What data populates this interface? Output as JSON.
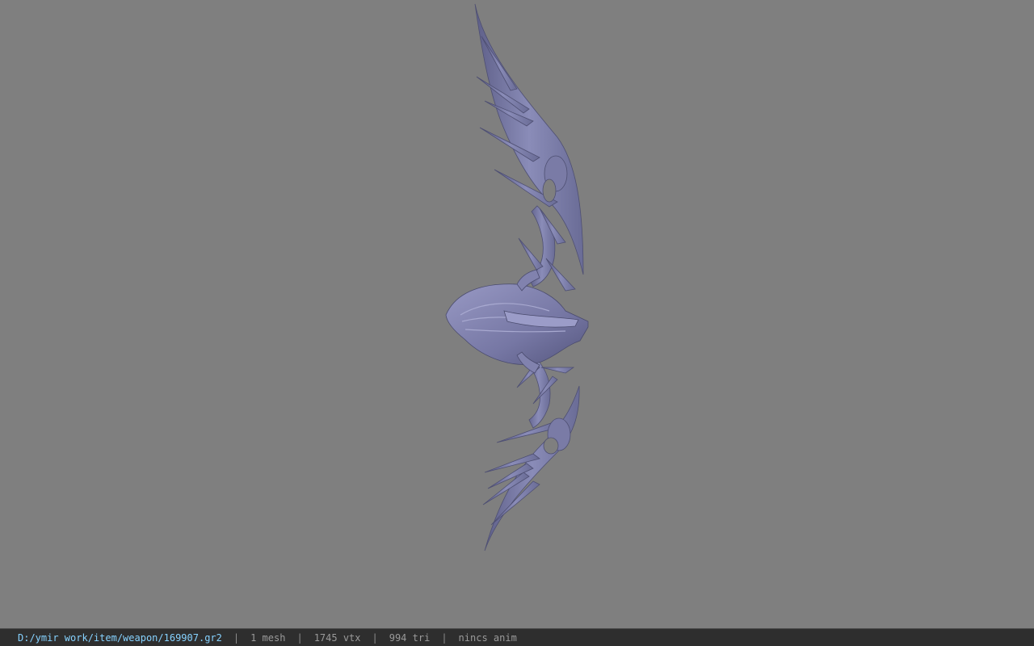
{
  "viewer": {
    "background_color": "#7f7f7f",
    "model_color": "#7f80a8",
    "model_icon": "bow-weapon-mesh"
  },
  "status_bar": {
    "file_path": "D:/ymir work/item/weapon/169907.gr2",
    "mesh_count": "1 mesh",
    "vertex_count": "1745 vtx",
    "triangle_count": "994 tri",
    "anim_status": "nincs anim",
    "separator": "|",
    "path_color": "#86d2ff"
  }
}
